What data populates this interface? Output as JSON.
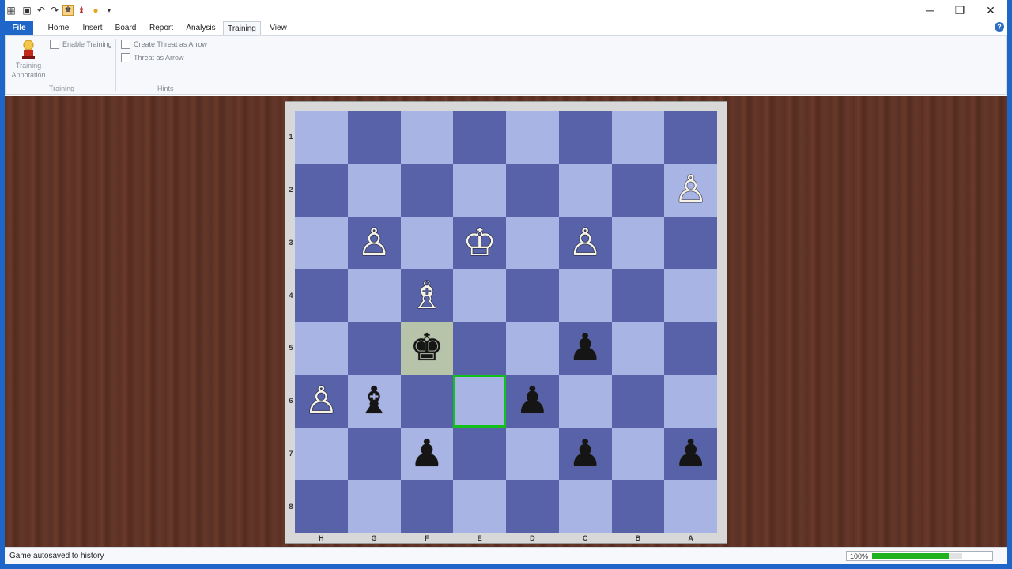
{
  "quick_access": [
    "board-icon",
    "save-icon",
    "undo-icon",
    "redo-icon",
    "training-icon",
    "annotation-icon",
    "lightbulb-icon",
    "dropdown-icon"
  ],
  "window": {
    "minimize": "─",
    "restore": "❐",
    "close": "✕"
  },
  "tabs": {
    "file": "File",
    "home": "Home",
    "insert": "Insert",
    "board": "Board",
    "report": "Report",
    "analysis": "Analysis",
    "training": "Training",
    "view": "View",
    "active": "Training"
  },
  "ribbon": {
    "training_annotation": {
      "line1": "Training",
      "line2": "Annotation"
    },
    "enable_training": {
      "label": "Enable Training",
      "checked": false
    },
    "create_threat_as_arrow": {
      "label": "Create Threat as Arrow",
      "checked": false
    },
    "threat_as_arrow": {
      "label": "Threat as Arrow",
      "checked": false
    },
    "group_training": "Training",
    "group_hints": "Hints"
  },
  "board": {
    "files": [
      "H",
      "G",
      "F",
      "E",
      "D",
      "C",
      "B",
      "A"
    ],
    "ranks": [
      "1",
      "2",
      "3",
      "4",
      "5",
      "6",
      "7",
      "8"
    ],
    "pieces": {
      "A2": "♙",
      "G3": "♙",
      "E3": "♔",
      "C3": "♙",
      "F4": "♗",
      "F5": "♚",
      "C5": "♟",
      "H6": "♙",
      "G6": "♝",
      "D6": "♟",
      "F7": "♟",
      "C7": "♟",
      "A7": "♟"
    },
    "piece_colors": {
      "A2": "w",
      "G3": "w",
      "E3": "w",
      "C3": "w",
      "F4": "w",
      "F5": "b",
      "C5": "b",
      "H6": "w",
      "G6": "b",
      "D6": "b",
      "F7": "b",
      "C7": "b",
      "A7": "b"
    },
    "highlight_square": "F5",
    "target_square": "E6"
  },
  "status": {
    "message": "Game autosaved to history",
    "zoom": "100%",
    "progress": 0.85
  },
  "colors": {
    "accent": "#1e67c9",
    "light_square": "#a8b4e4",
    "dark_square": "#5762a8",
    "progress": "#1eb31e"
  }
}
